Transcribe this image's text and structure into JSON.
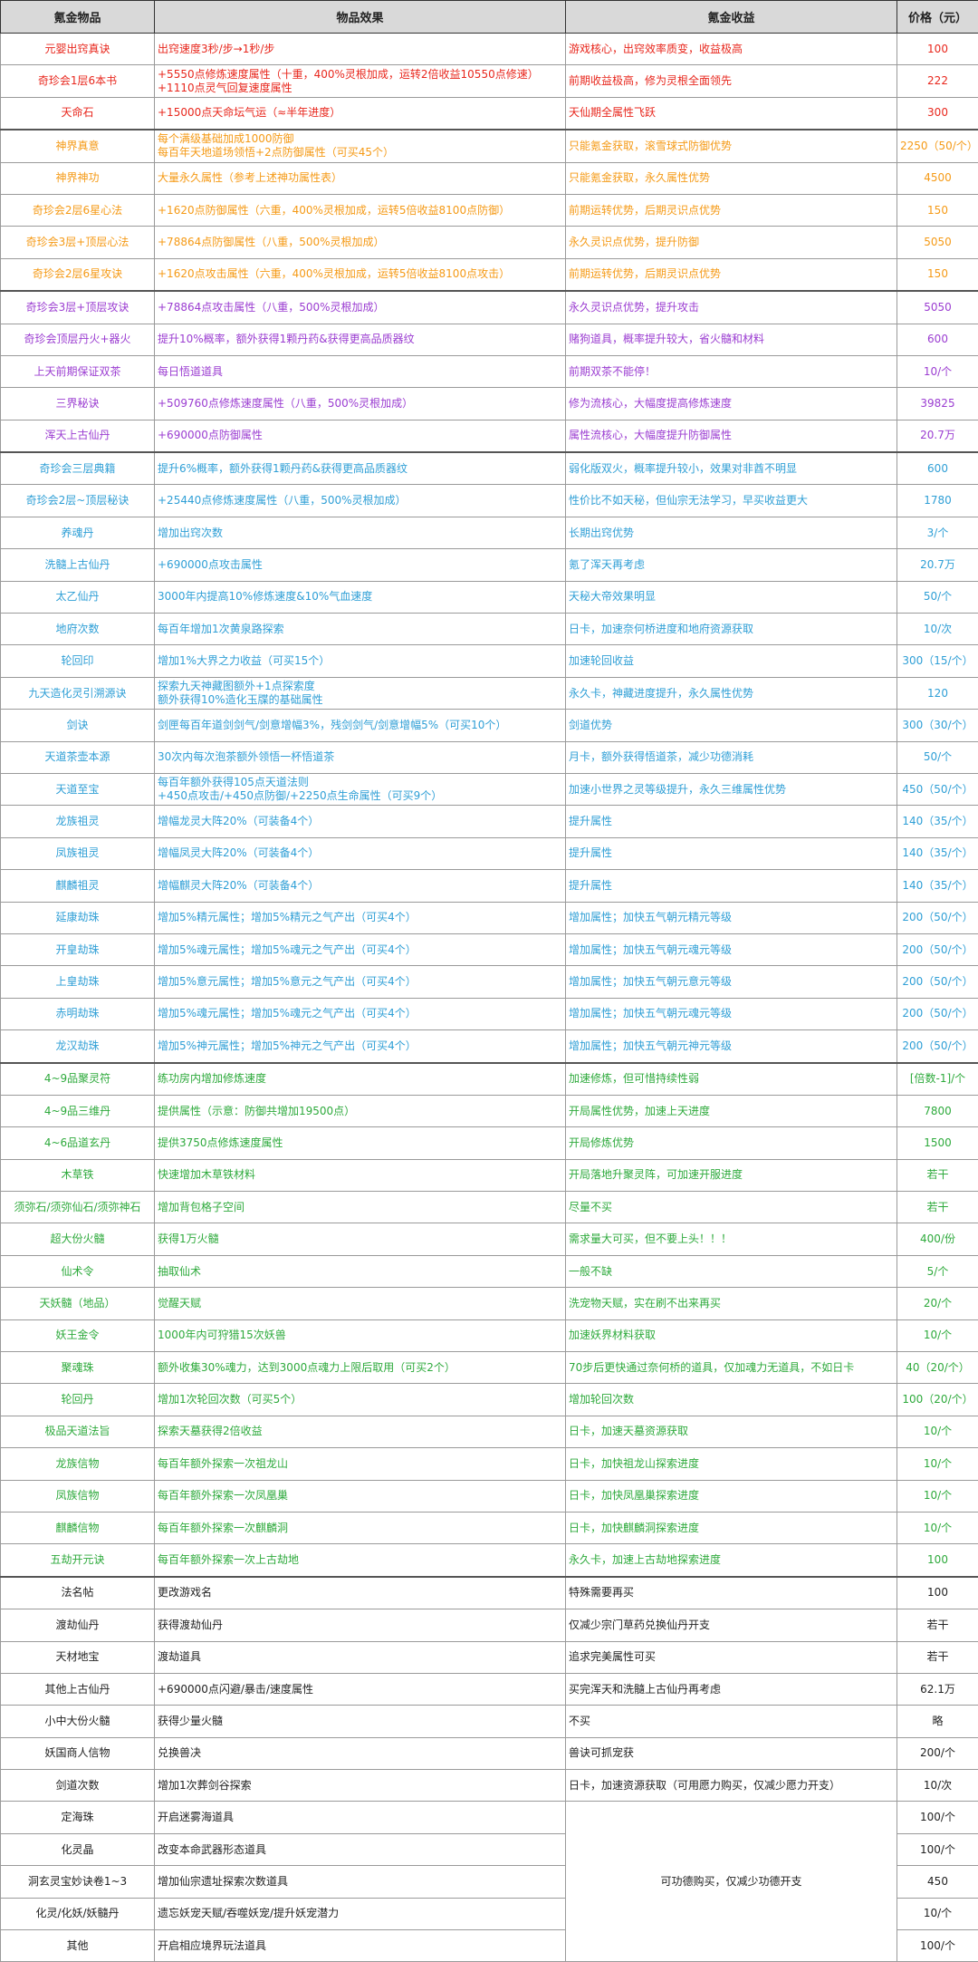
{
  "header": [
    "氪金物品",
    "物品效果",
    "氪金收益",
    "价格（元）"
  ],
  "colors": {
    "red": "#e8271d",
    "orange": "#f59a16",
    "purple": "#9b3dd1",
    "blue": "#2f9fd6",
    "green": "#2eaa3c",
    "black": "#222222",
    "header_bg": "#d9d9d9"
  },
  "rows": [
    {
      "color": "red",
      "name": "元婴出窍真诀",
      "effect": [
        "出窍速度3秒/步→1秒/步"
      ],
      "gain": "游戏核心，出窍效率质变，收益极高",
      "price": "100"
    },
    {
      "color": "red",
      "name": "奇珍会1层6本书",
      "effect": [
        "+5550点修炼速度属性（十重，400%灵根加成，运转2倍收益10550点修速）",
        "+1110点灵气回复速度属性"
      ],
      "gain": "前期收益极高，修为灵根全面领先",
      "price": "222"
    },
    {
      "color": "red",
      "name": "天命石",
      "effect": [
        "+15000点天命坛气运（≈半年进度）"
      ],
      "gain": "天仙期全属性飞跃",
      "price": "300"
    },
    {
      "color": "orange",
      "sep": true,
      "name": "神界真意",
      "effect": [
        "每个满级基础加成1000防御",
        "每百年天地道场领悟+2点防御属性（可买45个）"
      ],
      "gain": "只能氪金获取，滚雪球式防御优势",
      "price": "2250（50/个）"
    },
    {
      "color": "orange",
      "name": "神界神功",
      "effect": [
        "大量永久属性（参考上述神功属性表）"
      ],
      "gain": "只能氪金获取，永久属性优势",
      "price": "4500"
    },
    {
      "color": "orange",
      "name": "奇珍会2层6星心法",
      "effect": [
        "+1620点防御属性（六重，400%灵根加成，运转5倍收益8100点防御）"
      ],
      "gain": "前期运转优势，后期灵识点优势",
      "price": "150"
    },
    {
      "color": "orange",
      "name": "奇珍会3层+顶层心法",
      "effect": [
        "+78864点防御属性（八重，500%灵根加成）"
      ],
      "gain": "永久灵识点优势，提升防御",
      "price": "5050"
    },
    {
      "color": "orange",
      "name": "奇珍会2层6星攻诀",
      "effect": [
        "+1620点攻击属性（六重，400%灵根加成，运转5倍收益8100点攻击）"
      ],
      "gain": "前期运转优势，后期灵识点优势",
      "price": "150"
    },
    {
      "color": "purple",
      "sep": true,
      "name": "奇珍会3层+顶层攻诀",
      "effect": [
        "+78864点攻击属性（八重，500%灵根加成）"
      ],
      "gain": "永久灵识点优势，提升攻击",
      "price": "5050"
    },
    {
      "color": "purple",
      "name": "奇珍会顶层丹火+器火",
      "effect": [
        "提升10%概率，额外获得1颗丹药&获得更高品质器纹"
      ],
      "gain": "赌狗道具，概率提升较大，省火髓和材料",
      "price": "600"
    },
    {
      "color": "purple",
      "name": "上天前期保证双茶",
      "effect": [
        "每日悟道道具"
      ],
      "gain": "前期双茶不能停！",
      "price": "10/个"
    },
    {
      "color": "purple",
      "name": "三界秘诀",
      "effect": [
        "+509760点修炼速度属性（八重，500%灵根加成）"
      ],
      "gain": "修为流核心，大幅度提高修炼速度",
      "price": "39825"
    },
    {
      "color": "purple",
      "name": "浑天上古仙丹",
      "effect": [
        "+690000点防御属性"
      ],
      "gain": "属性流核心，大幅度提升防御属性",
      "price": "20.7万"
    },
    {
      "color": "blue",
      "sep": true,
      "name": "奇珍会三层典籍",
      "effect": [
        "提升6%概率，额外获得1颗丹药&获得更高品质器纹"
      ],
      "gain": "弱化版双火，概率提升较小，效果对非酋不明显",
      "price": "600"
    },
    {
      "color": "blue",
      "name": "奇珍会2层~顶层秘诀",
      "effect": [
        "+25440点修炼速度属性（八重，500%灵根加成）"
      ],
      "gain": "性价比不如天秘，但仙宗无法学习，早买收益更大",
      "price": "1780"
    },
    {
      "color": "blue",
      "name": "养魂丹",
      "effect": [
        "增加出窍次数"
      ],
      "gain": "长期出窍优势",
      "price": "3/个"
    },
    {
      "color": "blue",
      "name": "洗髓上古仙丹",
      "effect": [
        "+690000点攻击属性"
      ],
      "gain": "氪了浑天再考虑",
      "price": "20.7万"
    },
    {
      "color": "blue",
      "name": "太乙仙丹",
      "effect": [
        "3000年内提高10%修炼速度&10%气血速度"
      ],
      "gain": "天秘大帝效果明显",
      "price": "50/个"
    },
    {
      "color": "blue",
      "name": "地府次数",
      "effect": [
        "每百年增加1次黄泉路探索"
      ],
      "gain": "日卡，加速奈何桥进度和地府资源获取",
      "price": "10/次"
    },
    {
      "color": "blue",
      "name": "轮回印",
      "effect": [
        "增加1%大界之力收益（可买15个）"
      ],
      "gain": "加速轮回收益",
      "price": "300（15/个）"
    },
    {
      "color": "blue",
      "name": "九天造化灵引溯源诀",
      "effect": [
        "探索九天神藏图额外+1点探索度",
        "额外获得10%造化玉牒的基础属性"
      ],
      "gain": "永久卡，神藏进度提升，永久属性优势",
      "price": "120"
    },
    {
      "color": "blue",
      "name": "剑诀",
      "effect": [
        "剑匣每百年道剑剑气/剑意增幅3%，残剑剑气/剑意增幅5%（可买10个）"
      ],
      "gain": "剑道优势",
      "price": "300（30/个）"
    },
    {
      "color": "blue",
      "name": "天道茶壶本源",
      "effect": [
        "30次内每次泡茶额外领悟一杯悟道茶"
      ],
      "gain": "月卡，额外获得悟道茶，减少功德消耗",
      "price": "50/个"
    },
    {
      "color": "blue",
      "name": "天道至宝",
      "effect": [
        "每百年额外获得105点天道法则",
        "+450点攻击/+450点防御/+2250点生命属性（可买9个）"
      ],
      "gain": "加速小世界之灵等级提升，永久三维属性优势",
      "price": "450（50/个）"
    },
    {
      "color": "blue",
      "name": "龙族祖灵",
      "effect": [
        "增幅龙灵大阵20%（可装备4个）"
      ],
      "gain": "提升属性",
      "price": "140（35/个）"
    },
    {
      "color": "blue",
      "name": "凤族祖灵",
      "effect": [
        "增幅凤灵大阵20%（可装备4个）"
      ],
      "gain": "提升属性",
      "price": "140（35/个）"
    },
    {
      "color": "blue",
      "name": "麒麟祖灵",
      "effect": [
        "增幅麒灵大阵20%（可装备4个）"
      ],
      "gain": "提升属性",
      "price": "140（35/个）"
    },
    {
      "color": "blue",
      "name": "延康劫珠",
      "effect": [
        "增加5%精元属性；增加5%精元之气产出（可买4个）"
      ],
      "gain": "增加属性；加快五气朝元精元等级",
      "price": "200（50/个）"
    },
    {
      "color": "blue",
      "name": "开皇劫珠",
      "effect": [
        "增加5%魂元属性；增加5%魂元之气产出（可买4个）"
      ],
      "gain": "增加属性；加快五气朝元魂元等级",
      "price": "200（50/个）"
    },
    {
      "color": "blue",
      "name": "上皇劫珠",
      "effect": [
        "增加5%意元属性；增加5%意元之气产出（可买4个）"
      ],
      "gain": "增加属性；加快五气朝元意元等级",
      "price": "200（50/个）"
    },
    {
      "color": "blue",
      "name": "赤明劫珠",
      "effect": [
        "增加5%魂元属性；增加5%魂元之气产出（可买4个）"
      ],
      "gain": "增加属性；加快五气朝元魂元等级",
      "price": "200（50/个）"
    },
    {
      "color": "blue",
      "name": "龙汉劫珠",
      "effect": [
        "增加5%神元属性；增加5%神元之气产出（可买4个）"
      ],
      "gain": "增加属性；加快五气朝元神元等级",
      "price": "200（50/个）"
    },
    {
      "color": "green",
      "sep": true,
      "name": "4~9品聚灵符",
      "effect": [
        "练功房内增加修炼速度"
      ],
      "gain": "加速修炼，但可惜持续性弱",
      "price": "[倍数-1]/个"
    },
    {
      "color": "green",
      "name": "4~9品三维丹",
      "effect": [
        "提供属性（示意：防御共增加19500点）"
      ],
      "gain": "开局属性优势，加速上天进度",
      "price": "7800"
    },
    {
      "color": "green",
      "name": "4~6品道玄丹",
      "effect": [
        "提供3750点修炼速度属性"
      ],
      "gain": "开局修炼优势",
      "price": "1500"
    },
    {
      "color": "green",
      "name": "木草铁",
      "effect": [
        "快速增加木草铁材料"
      ],
      "gain": "开局落地升聚灵阵，可加速开服进度",
      "price": "若干"
    },
    {
      "color": "green",
      "name": "须弥石/须弥仙石/须弥神石",
      "effect": [
        "增加背包格子空间"
      ],
      "gain": "尽量不买",
      "price": "若干"
    },
    {
      "color": "green",
      "name": "超大份火髓",
      "effect": [
        "获得1万火髓"
      ],
      "gain": "需求量大可买，但不要上头！！！",
      "price": "400/份"
    },
    {
      "color": "green",
      "name": "仙术令",
      "effect": [
        "抽取仙术"
      ],
      "gain": "一般不缺",
      "price": "5/个"
    },
    {
      "color": "green",
      "name": "天妖髓（地品）",
      "effect": [
        "觉醒天赋"
      ],
      "gain": "洗宠物天赋，实在刷不出来再买",
      "price": "20/个"
    },
    {
      "color": "green",
      "name": "妖王金令",
      "effect": [
        "1000年内可狩猎15次妖兽"
      ],
      "gain": "加速妖界材料获取",
      "price": "10/个"
    },
    {
      "color": "green",
      "name": "聚魂珠",
      "effect": [
        "额外收集30%魂力，达到3000点魂力上限后取用（可买2个）"
      ],
      "gain": "70步后更快通过奈何桥的道具，仅加魂力无道具，不如日卡",
      "price": "40（20/个）"
    },
    {
      "color": "green",
      "name": "轮回丹",
      "effect": [
        "增加1次轮回次数（可买5个）"
      ],
      "gain": "增加轮回次数",
      "price": "100（20/个）"
    },
    {
      "color": "green",
      "name": "极品天道法旨",
      "effect": [
        "探索天墓获得2倍收益"
      ],
      "gain": "日卡，加速天墓资源获取",
      "price": "10/个"
    },
    {
      "color": "green",
      "name": "龙族信物",
      "effect": [
        "每百年额外探索一次祖龙山"
      ],
      "gain": "日卡，加快祖龙山探索进度",
      "price": "10/个"
    },
    {
      "color": "green",
      "name": "凤族信物",
      "effect": [
        "每百年额外探索一次凤凰巢"
      ],
      "gain": "日卡，加快凤凰巢探索进度",
      "price": "10/个"
    },
    {
      "color": "green",
      "name": "麒麟信物",
      "effect": [
        "每百年额外探索一次麒麟洞"
      ],
      "gain": "日卡，加快麒麟洞探索进度",
      "price": "10/个"
    },
    {
      "color": "green",
      "name": "五劫开元诀",
      "effect": [
        "每百年额外探索一次上古劫地"
      ],
      "gain": "永久卡，加速上古劫地探索进度",
      "price": "100"
    },
    {
      "color": "black",
      "sep": true,
      "name": "法名帖",
      "effect": [
        "更改游戏名"
      ],
      "gain": "特殊需要再买",
      "price": "100"
    },
    {
      "color": "black",
      "name": "渡劫仙丹",
      "effect": [
        "获得渡劫仙丹"
      ],
      "gain": "仅减少宗门草药兑换仙丹开支",
      "price": "若干"
    },
    {
      "color": "black",
      "name": "天材地宝",
      "effect": [
        "渡劫道具"
      ],
      "gain": "追求完美属性可买",
      "price": "若干"
    },
    {
      "color": "black",
      "name": "其他上古仙丹",
      "effect": [
        "+690000点闪避/暴击/速度属性"
      ],
      "gain": "买完浑天和洗髓上古仙丹再考虑",
      "price": "62.1万"
    },
    {
      "color": "black",
      "name": "小中大份火髓",
      "effect": [
        "获得少量火髓"
      ],
      "gain": "不买",
      "price": "略"
    },
    {
      "color": "black",
      "name": "妖国商人信物",
      "effect": [
        "兑换兽决"
      ],
      "gain": "兽诀可抓宠获",
      "price": "200/个"
    },
    {
      "color": "black",
      "name": "剑道次数",
      "effect": [
        "增加1次葬剑谷探索"
      ],
      "gain": "日卡，加速资源获取（可用愿力购买，仅减少愿力开支）",
      "price": "10/次"
    },
    {
      "color": "black",
      "name": "定海珠",
      "effect": [
        "开启迷雾海道具"
      ],
      "merged_gain": "可功德购买，仅减少功德开支",
      "merged_span": 5,
      "price": "100/个"
    },
    {
      "color": "black",
      "name": "化灵晶",
      "effect": [
        "改变本命武器形态道具"
      ],
      "price": "100/个"
    },
    {
      "color": "black",
      "name": "洞玄灵宝妙诀卷1~3",
      "effect": [
        "增加仙宗遗址探索次数道具"
      ],
      "price": "450"
    },
    {
      "color": "black",
      "name": "化灵/化妖/妖髓丹",
      "effect": [
        "遗忘妖宠天赋/吞噬妖宠/提升妖宠潜力"
      ],
      "price": "10/个"
    },
    {
      "color": "black",
      "name": "其他",
      "effect": [
        "开启相应境界玩法道具"
      ],
      "price": "100/个"
    }
  ]
}
